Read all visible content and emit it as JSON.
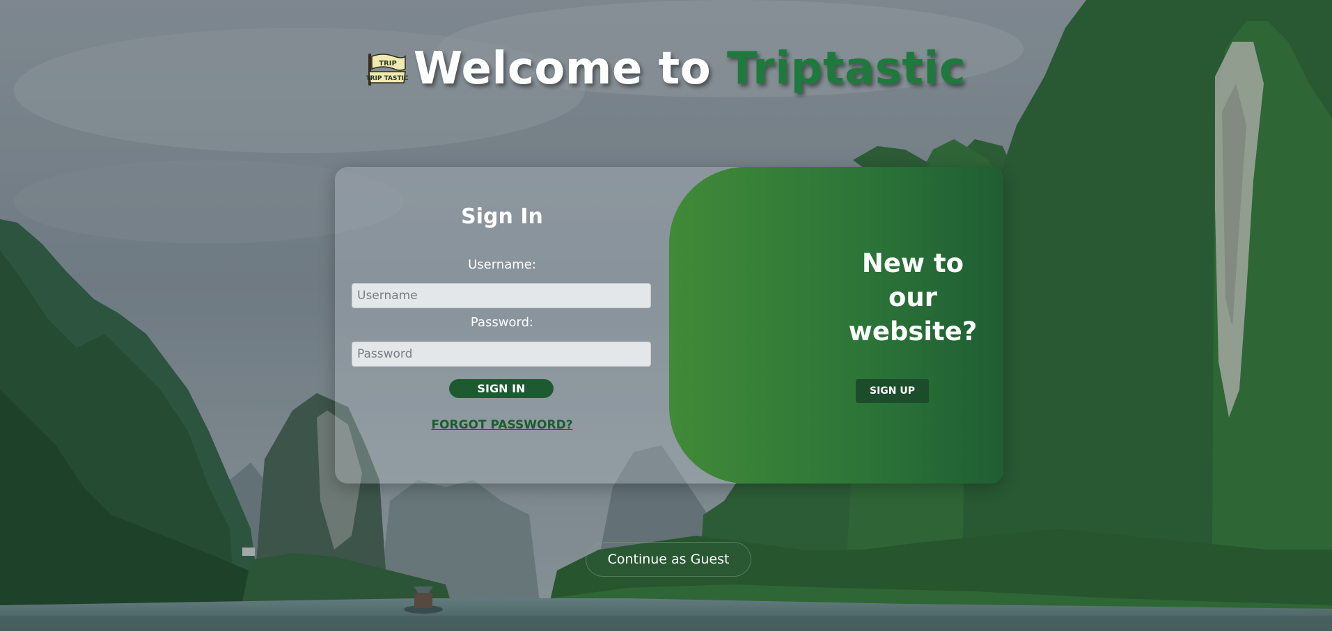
{
  "header": {
    "title_prefix": "Welcome to",
    "title_brand": "Triptastic",
    "logo_text_top": "TRIP",
    "logo_text_bottom": "TRIP TASTIC"
  },
  "signin": {
    "title": "Sign In",
    "username_label": "Username:",
    "username_placeholder": "Username",
    "username_value": "",
    "password_label": "Password:",
    "password_placeholder": "Password",
    "password_value": "",
    "submit_label": "SIGN IN",
    "forgot_label": "FORGOT PASSWORD?"
  },
  "signup": {
    "title": "New to our website?",
    "button_label": "SIGN UP"
  },
  "guest": {
    "button_label": "Continue as Guest"
  },
  "colors": {
    "brand_green": "#1e7a3c",
    "button_green": "#1d5a32",
    "panel_gradient_start": "#418a38",
    "panel_gradient_end": "#1f5e33"
  },
  "icons": {
    "logo": "triptastic-flag-logo"
  }
}
